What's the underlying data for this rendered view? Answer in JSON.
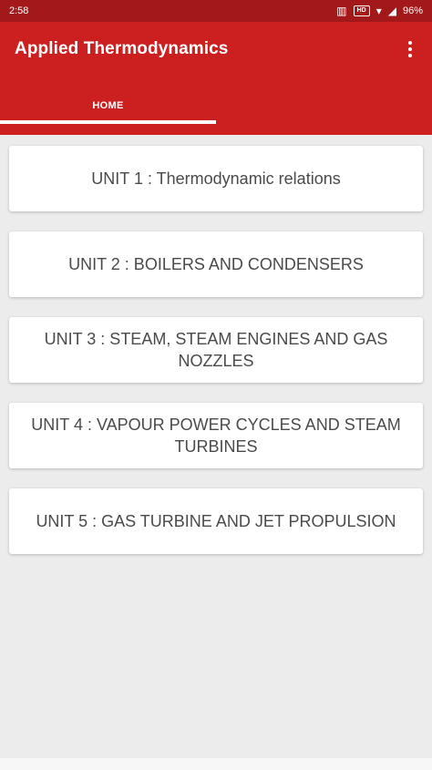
{
  "status": {
    "time": "2:58",
    "hd_label": "HD",
    "battery": "96%"
  },
  "appbar": {
    "title": "Applied Thermodynamics"
  },
  "tabs": [
    {
      "label": "HOME",
      "selected": true
    },
    {
      "label": "",
      "selected": false
    }
  ],
  "units": [
    {
      "label": "UNIT 1 : Thermodynamic relations"
    },
    {
      "label": "UNIT 2 : BOILERS AND CONDENSERS"
    },
    {
      "label": "UNIT 3 : STEAM, STEAM ENGINES AND GAS NOZZLES"
    },
    {
      "label": "UNIT 4 : VAPOUR POWER CYCLES AND STEAM TURBINES"
    },
    {
      "label": "UNIT 5 : GAS TURBINE AND JET PROPULSION"
    }
  ],
  "colors": {
    "status_bar": "#a31919",
    "app_bar": "#cc1f1f",
    "background": "#ececec",
    "card": "#ffffff",
    "card_text": "#4a4a4a"
  }
}
